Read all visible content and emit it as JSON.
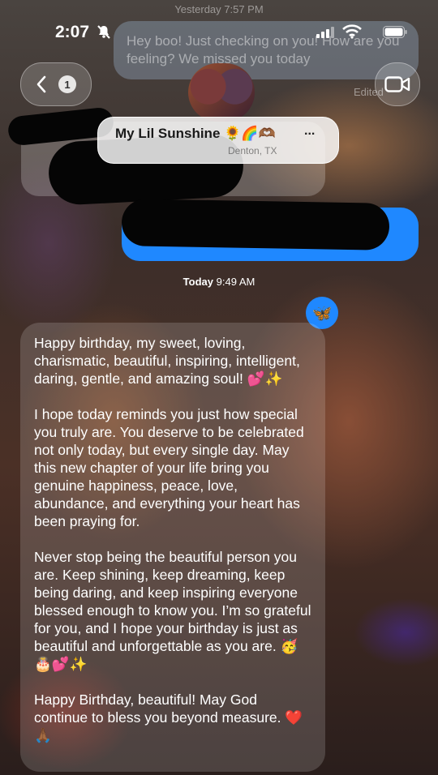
{
  "status_bar": {
    "time": "2:07",
    "bell": "bell-slash-icon"
  },
  "history": {
    "label": "Yesterday 7:57 PM",
    "outgoing_text": "Hey boo! Just checking on you! How are you feeling? We missed you today",
    "edited": "Edited"
  },
  "header": {
    "back_count": "1",
    "contact_name": "My Lil Sunshine 🌻🌈🫶🏾",
    "more": "...",
    "location": "Denton, TX"
  },
  "messages": {
    "timestamp_day": "Today",
    "timestamp_time": "9:49 AM",
    "reaction": "🦋",
    "body": "Happy birthday, my sweet, loving, charismatic, beautiful, inspiring, intelligent, daring, gentle, and amazing soul! 💕✨\n\nI hope today reminds you just how special you truly are. You deserve to be celebrated not only today, but every single day. May this new chapter of your life bring you genuine happiness, peace, love, abundance, and everything your heart has been praying for.\n\nNever stop being the beautiful person you are. Keep shining, keep dreaming, keep being daring, and keep inspiring everyone blessed enough to know you. I’m so grateful for you, and I hope your birthday is just as beautiful and unforgettable as you are. 🥳🎂💕✨\n\nHappy Birthday, beautiful! May God continue to bless you beyond measure. ❤️🙏🏾"
  },
  "colors": {
    "imessage_blue": "#1f88ff"
  }
}
